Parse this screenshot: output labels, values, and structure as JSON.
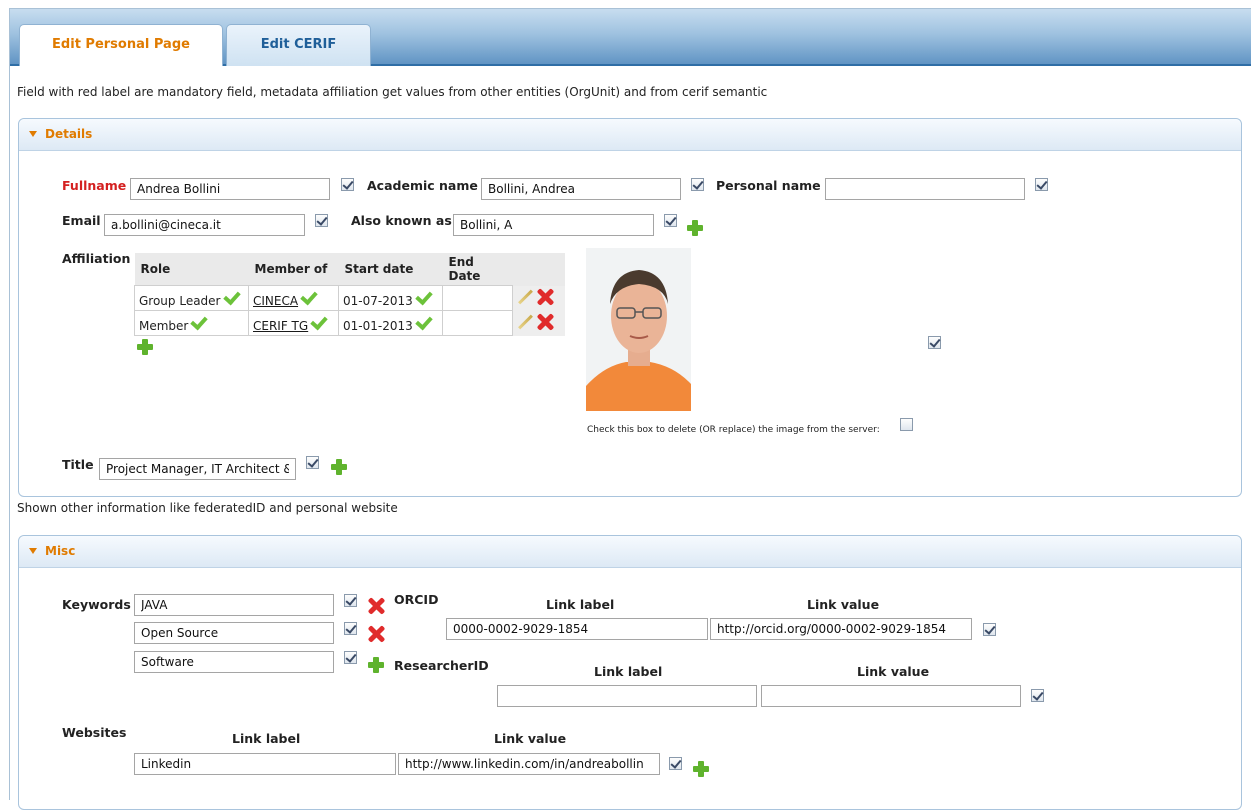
{
  "tabs": {
    "active": "Edit Personal Page",
    "inactive": "Edit CERIF"
  },
  "intro": "Field with red label are mandatory field, metadata affiliation get values from other entities (OrgUnit) and from cerif semantic",
  "details": {
    "header": "Details",
    "fullname": {
      "label": "Fullname",
      "value": "Andrea Bollini"
    },
    "academic_name": {
      "label": "Academic name",
      "value": "Bollini, Andrea"
    },
    "personal_name": {
      "label": "Personal name",
      "value": ""
    },
    "email": {
      "label": "Email",
      "value": "a.bollini@cineca.it"
    },
    "also_known_as": {
      "label": "Also known as",
      "value": "Bollini, A"
    },
    "affiliation": {
      "label": "Affiliation",
      "columns": [
        "Role",
        "Member of",
        "Start date",
        "End Date"
      ],
      "rows": [
        {
          "role": "Group Leader",
          "member_of": "CINECA",
          "start": "01-07-2013",
          "end": ""
        },
        {
          "role": "Member",
          "member_of": "CERIF TG",
          "start": "01-01-2013",
          "end": ""
        }
      ]
    },
    "image_delete_text": "Check this box to delete (OR replace) the image from the server:",
    "title": {
      "label": "Title",
      "value": "Project Manager, IT Architect &"
    }
  },
  "between_text": "Shown other information like federatedID and personal website",
  "misc": {
    "header": "Misc",
    "keywords": {
      "label": "Keywords",
      "values": [
        "JAVA",
        "Open Source",
        "Software"
      ]
    },
    "orcid": {
      "label": "ORCID",
      "link_label_head": "Link label",
      "link_value_head": "Link value",
      "link_label": "0000-0002-9029-1854",
      "link_value": "http://orcid.org/0000-0002-9029-1854"
    },
    "researcherid": {
      "label": "ResearcherID",
      "link_label_head": "Link label",
      "link_value_head": "Link value",
      "link_label": "",
      "link_value": ""
    },
    "websites": {
      "label": "Websites",
      "link_label_head": "Link label",
      "link_value_head": "Link value",
      "link_label": "Linkedin",
      "link_value": "http://www.linkedin.com/in/andreabollin"
    }
  },
  "colors": {
    "accent": "#e07b00",
    "required": "#d42020",
    "tab_blue": "#1f5f99"
  }
}
